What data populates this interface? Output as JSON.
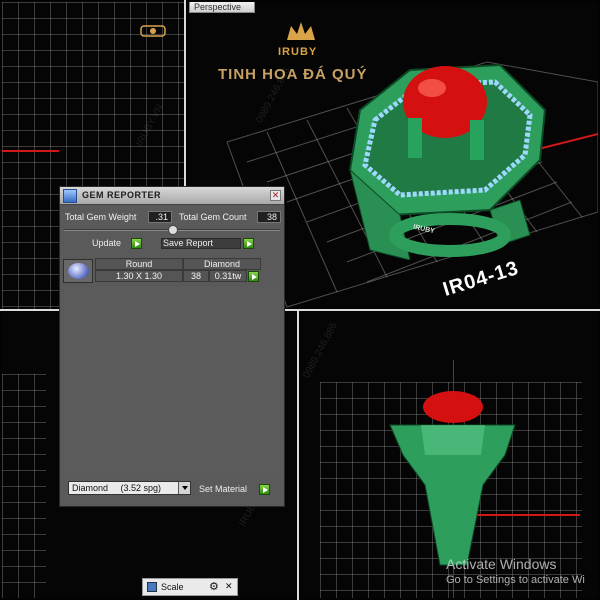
{
  "viewport": {
    "tab_label": "Perspective",
    "model_label": "IR04-13",
    "engraving": "IRUBY"
  },
  "branding": {
    "logo_text": "IRUBY",
    "tagline": "TINH HOA ĐÁ QUÝ",
    "small_logo_text": "IRUBY"
  },
  "gem_reporter": {
    "title": "GEM REPORTER",
    "total_weight_label": "Total Gem Weight",
    "total_weight_value": ".31",
    "total_count_label": "Total Gem Count",
    "total_count_value": "38",
    "update_label": "Update",
    "save_report_label": "Save Report",
    "table": {
      "headers": [
        "Round",
        "Diamond"
      ],
      "size": "1.30 X 1.30",
      "count": "38",
      "weight": "0.31tw"
    },
    "material_selected": "Diamond     (3.52 spg)",
    "set_material_label": "Set Material"
  },
  "scale_tab": {
    "label": "Scale"
  },
  "watermarks": [
    "0989.246.886",
    "IRUBY.VN"
  ],
  "activation": {
    "title": "Activate Windows",
    "subtitle": "Go to Settings to activate Wi"
  },
  "colors": {
    "ring_green": "#2e9e5c",
    "ruby_red": "#d41010",
    "grid_line": "#a0a0a0",
    "accent_gold": "#d9a34a"
  }
}
